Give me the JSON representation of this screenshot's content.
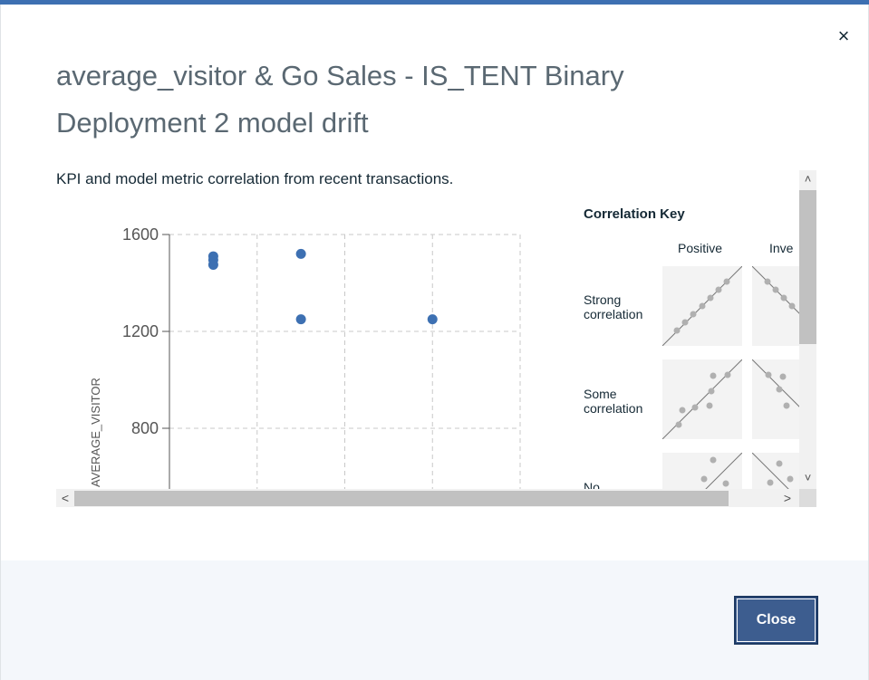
{
  "dialog": {
    "title": "average_visitor & Go Sales - IS_TENT Binary Deployment 2 model drift",
    "subtitle": "KPI and model metric correlation from recent transactions.",
    "close_icon": "×",
    "close_button_label": "Close"
  },
  "chart_data": {
    "type": "scatter",
    "ylabel": "AVERAGE_VISITOR",
    "yticks": [
      800,
      1200,
      1600
    ],
    "ylim": [
      580,
      1640
    ],
    "xlim": [
      0,
      4
    ],
    "grid": true,
    "points": [
      {
        "x": 0.5,
        "y": 1510
      },
      {
        "x": 0.5,
        "y": 1495
      },
      {
        "x": 0.5,
        "y": 1475
      },
      {
        "x": 1.5,
        "y": 1520
      },
      {
        "x": 1.5,
        "y": 1250
      },
      {
        "x": 3.0,
        "y": 1250
      }
    ],
    "color": "#3d70b2"
  },
  "correlation_key": {
    "title": "Correlation Key",
    "columns": [
      "Positive",
      "Inve"
    ],
    "rows": [
      {
        "label_line1": "Strong",
        "label_line2": "correlation"
      },
      {
        "label_line1": "Some",
        "label_line2": "correlation"
      },
      {
        "label_line1": "No",
        "label_line2": ""
      }
    ]
  },
  "scroll": {
    "up_arrow": "˄",
    "down_arrow": "˅",
    "left_arrow": "<",
    "right_arrow": ">"
  }
}
